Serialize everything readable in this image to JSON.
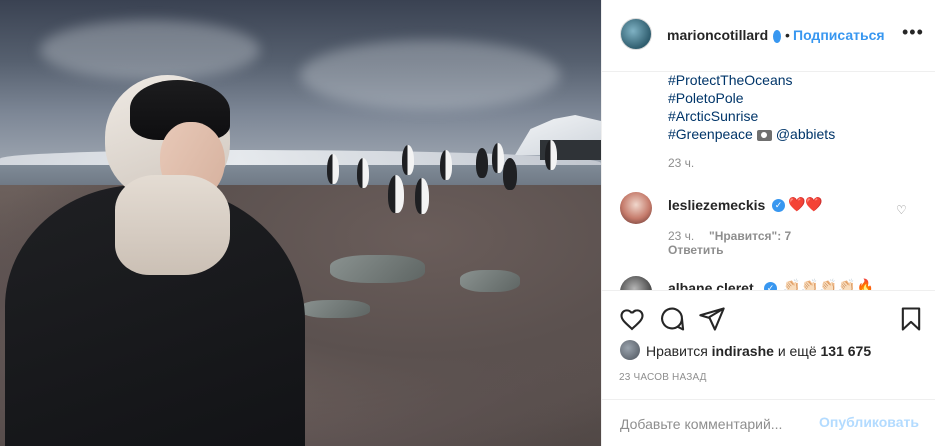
{
  "post": {
    "username": "marioncotillard",
    "dot": "•",
    "follow_label": "Подписаться",
    "more_label": "•••"
  },
  "caption": {
    "tags": [
      "#ProtectTheOceans",
      "#PoletoPole",
      "#ArcticSunrise",
      "#Greenpeace"
    ],
    "mention": "@abbiets",
    "time": "23 ч."
  },
  "comments": [
    {
      "username": "lesliezemeckis",
      "text": "❤️❤️",
      "time": "23 ч.",
      "likes": "\"Нравится\": 7",
      "reply_label": "Ответить"
    },
    {
      "username": "albane.cleret",
      "text": "👏🏻👏🏻👏🏻👏🏻🔥"
    }
  ],
  "likes": {
    "prefix": "Нравится",
    "user": "indirashe",
    "middle": "и ещё",
    "count": "131 675"
  },
  "timestamp": "23 ЧАСОВ НАЗАД",
  "add_comment": {
    "placeholder": "Добавьте комментарий...",
    "post_label": "Опубликовать"
  },
  "colors": {
    "accent": "#3897f0",
    "text": "#262626",
    "muted": "#8e8e8e",
    "hashtag": "#003569",
    "post_disabled": "#b3dbff"
  },
  "icons": [
    "heart-icon",
    "comment-icon",
    "share-icon",
    "bookmark-icon",
    "verified-icon",
    "camera-icon",
    "more-icon"
  ]
}
